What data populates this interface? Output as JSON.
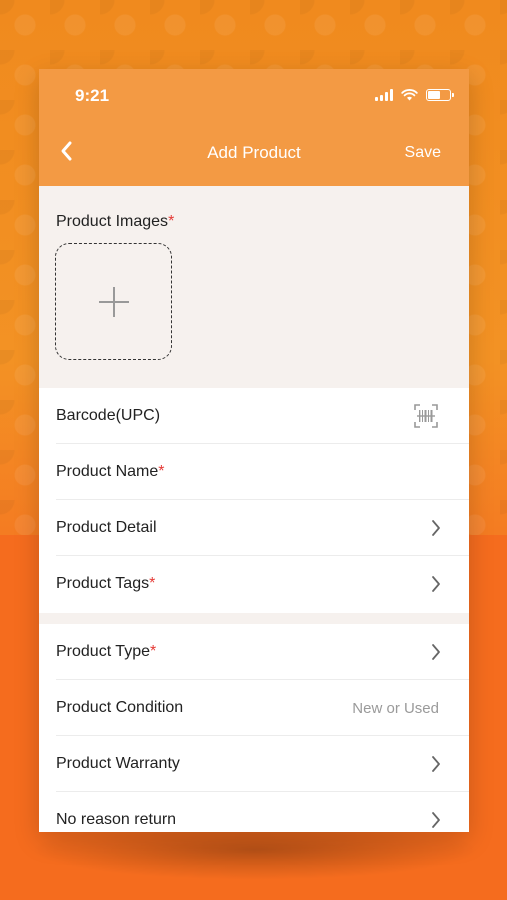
{
  "status_bar": {
    "time": "9:21"
  },
  "nav": {
    "title": "Add Product",
    "save_label": "Save"
  },
  "images": {
    "label": "Product Images",
    "required_mark": "*"
  },
  "rows_group1": [
    {
      "label": "Barcode(UPC)",
      "required": "",
      "icon": "barcode-scan-icon"
    },
    {
      "label": "Product Name",
      "required": "*"
    },
    {
      "label": "Product Detail",
      "required": "",
      "icon": "chevron-right-icon"
    },
    {
      "label": "Product Tags",
      "required": "*",
      "icon": "chevron-right-icon"
    }
  ],
  "rows_group2": [
    {
      "label": "Product Type",
      "required": "*",
      "icon": "chevron-right-icon"
    },
    {
      "label": "Product Condition",
      "required": "",
      "value": "New or Used"
    },
    {
      "label": "Product Warranty",
      "required": "",
      "icon": "chevron-right-icon"
    },
    {
      "label": "No reason return",
      "required": "",
      "icon": "chevron-right-icon"
    }
  ],
  "colors": {
    "header": "#f39a44",
    "required": "#e53935",
    "section_bg": "#f6f1ee",
    "background": "#f39224"
  }
}
